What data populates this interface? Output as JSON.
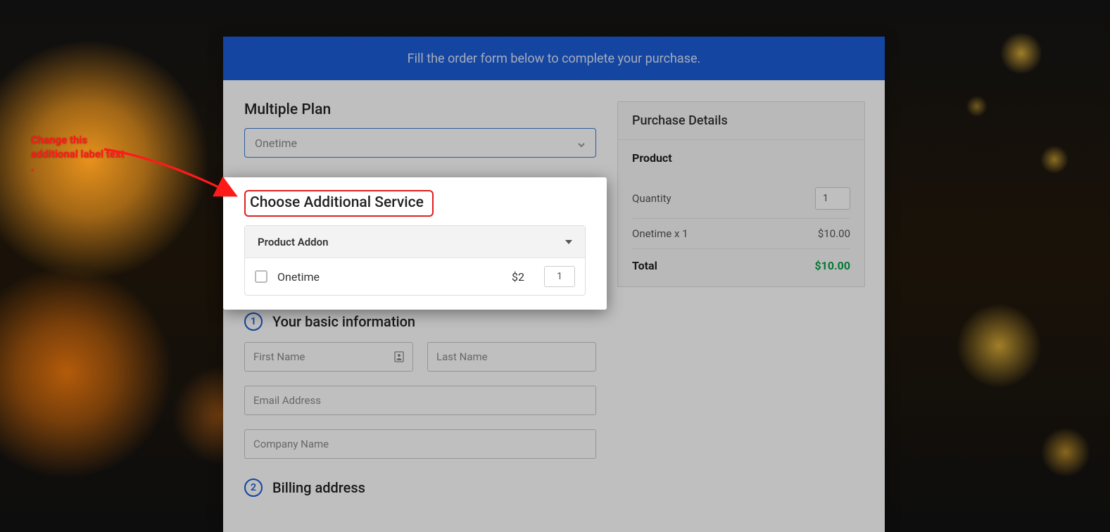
{
  "annotation": {
    "text": "Change this additional label text ."
  },
  "banner": "Fill the order form below to complete your purchase.",
  "plan": {
    "label": "Multiple Plan",
    "selected": "Onetime"
  },
  "additional": {
    "title": "Choose Additional Service",
    "panel_header": "Product Addon",
    "items": [
      {
        "name": "Onetime",
        "price": "$2",
        "qty": "1"
      }
    ]
  },
  "step1": {
    "num": "1",
    "title": "Your basic information",
    "first_name_ph": "First Name",
    "last_name_ph": "Last Name",
    "email_ph": "Email Address",
    "company_ph": "Company Name"
  },
  "step2": {
    "num": "2",
    "title": "Billing address"
  },
  "purchase": {
    "header": "Purchase Details",
    "product_label": "Product",
    "qty_label": "Quantity",
    "qty_value": "1",
    "line_item": "Onetime x 1",
    "line_price": "$10.00",
    "total_label": "Total",
    "total_value": "$10.00"
  }
}
